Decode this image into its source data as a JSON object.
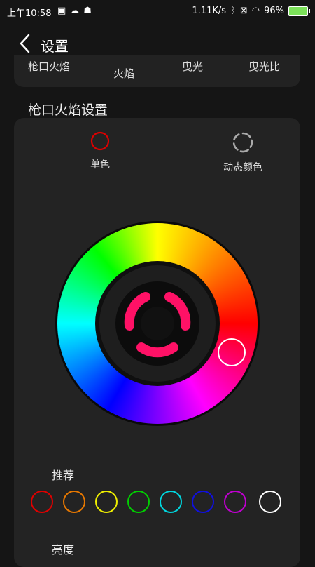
{
  "status": {
    "time": "上午10:58",
    "speed": "1.11K/s",
    "battery": "96%"
  },
  "header": {
    "title": "设置"
  },
  "tabs": [
    {
      "label": "枪口火焰"
    },
    {
      "label": "火焰"
    },
    {
      "label": "曳光"
    },
    {
      "label": "曳光比"
    }
  ],
  "section": {
    "title": "枪口火焰设置"
  },
  "modes": {
    "single": "单色",
    "dynamic": "动态颜色"
  },
  "recommend": {
    "label": "推荐"
  },
  "swatches": [
    {
      "color": "#e00000"
    },
    {
      "color": "#e87800"
    },
    {
      "color": "#f0f000"
    },
    {
      "color": "#00d000"
    },
    {
      "color": "#00d8e0"
    },
    {
      "color": "#1010e0"
    },
    {
      "color": "#c000d0"
    },
    {
      "color": "#ffffff"
    }
  ],
  "preview": {
    "color": "#ff1166"
  },
  "brightness": {
    "label": "亮度"
  }
}
